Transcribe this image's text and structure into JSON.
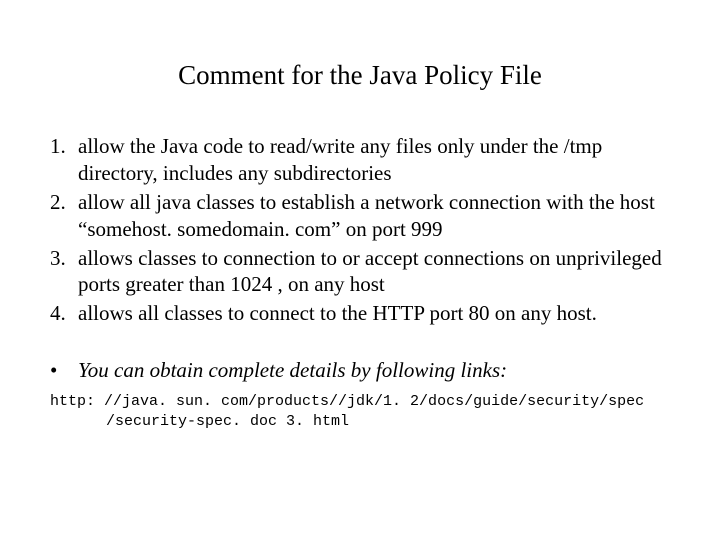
{
  "title": "Comment for the Java Policy File",
  "items": [
    "allow the Java code to read/write any files only under the /tmp directory, includes any subdirectories",
    " allow all java classes to establish a network connection with the host “somehost. somedomain. com” on port 999",
    " allows classes to connection to or accept connections on unprivileged ports greater than 1024 , on any host",
    " allows all classes to connect to the HTTP port 80 on any host."
  ],
  "bulletText": "You can obtain complete details by following links:",
  "urlLine1": "http: //java. sun. com/products//jdk/1. 2/docs/guide/security/spec",
  "urlLine2": "/security-spec. doc 3. html"
}
